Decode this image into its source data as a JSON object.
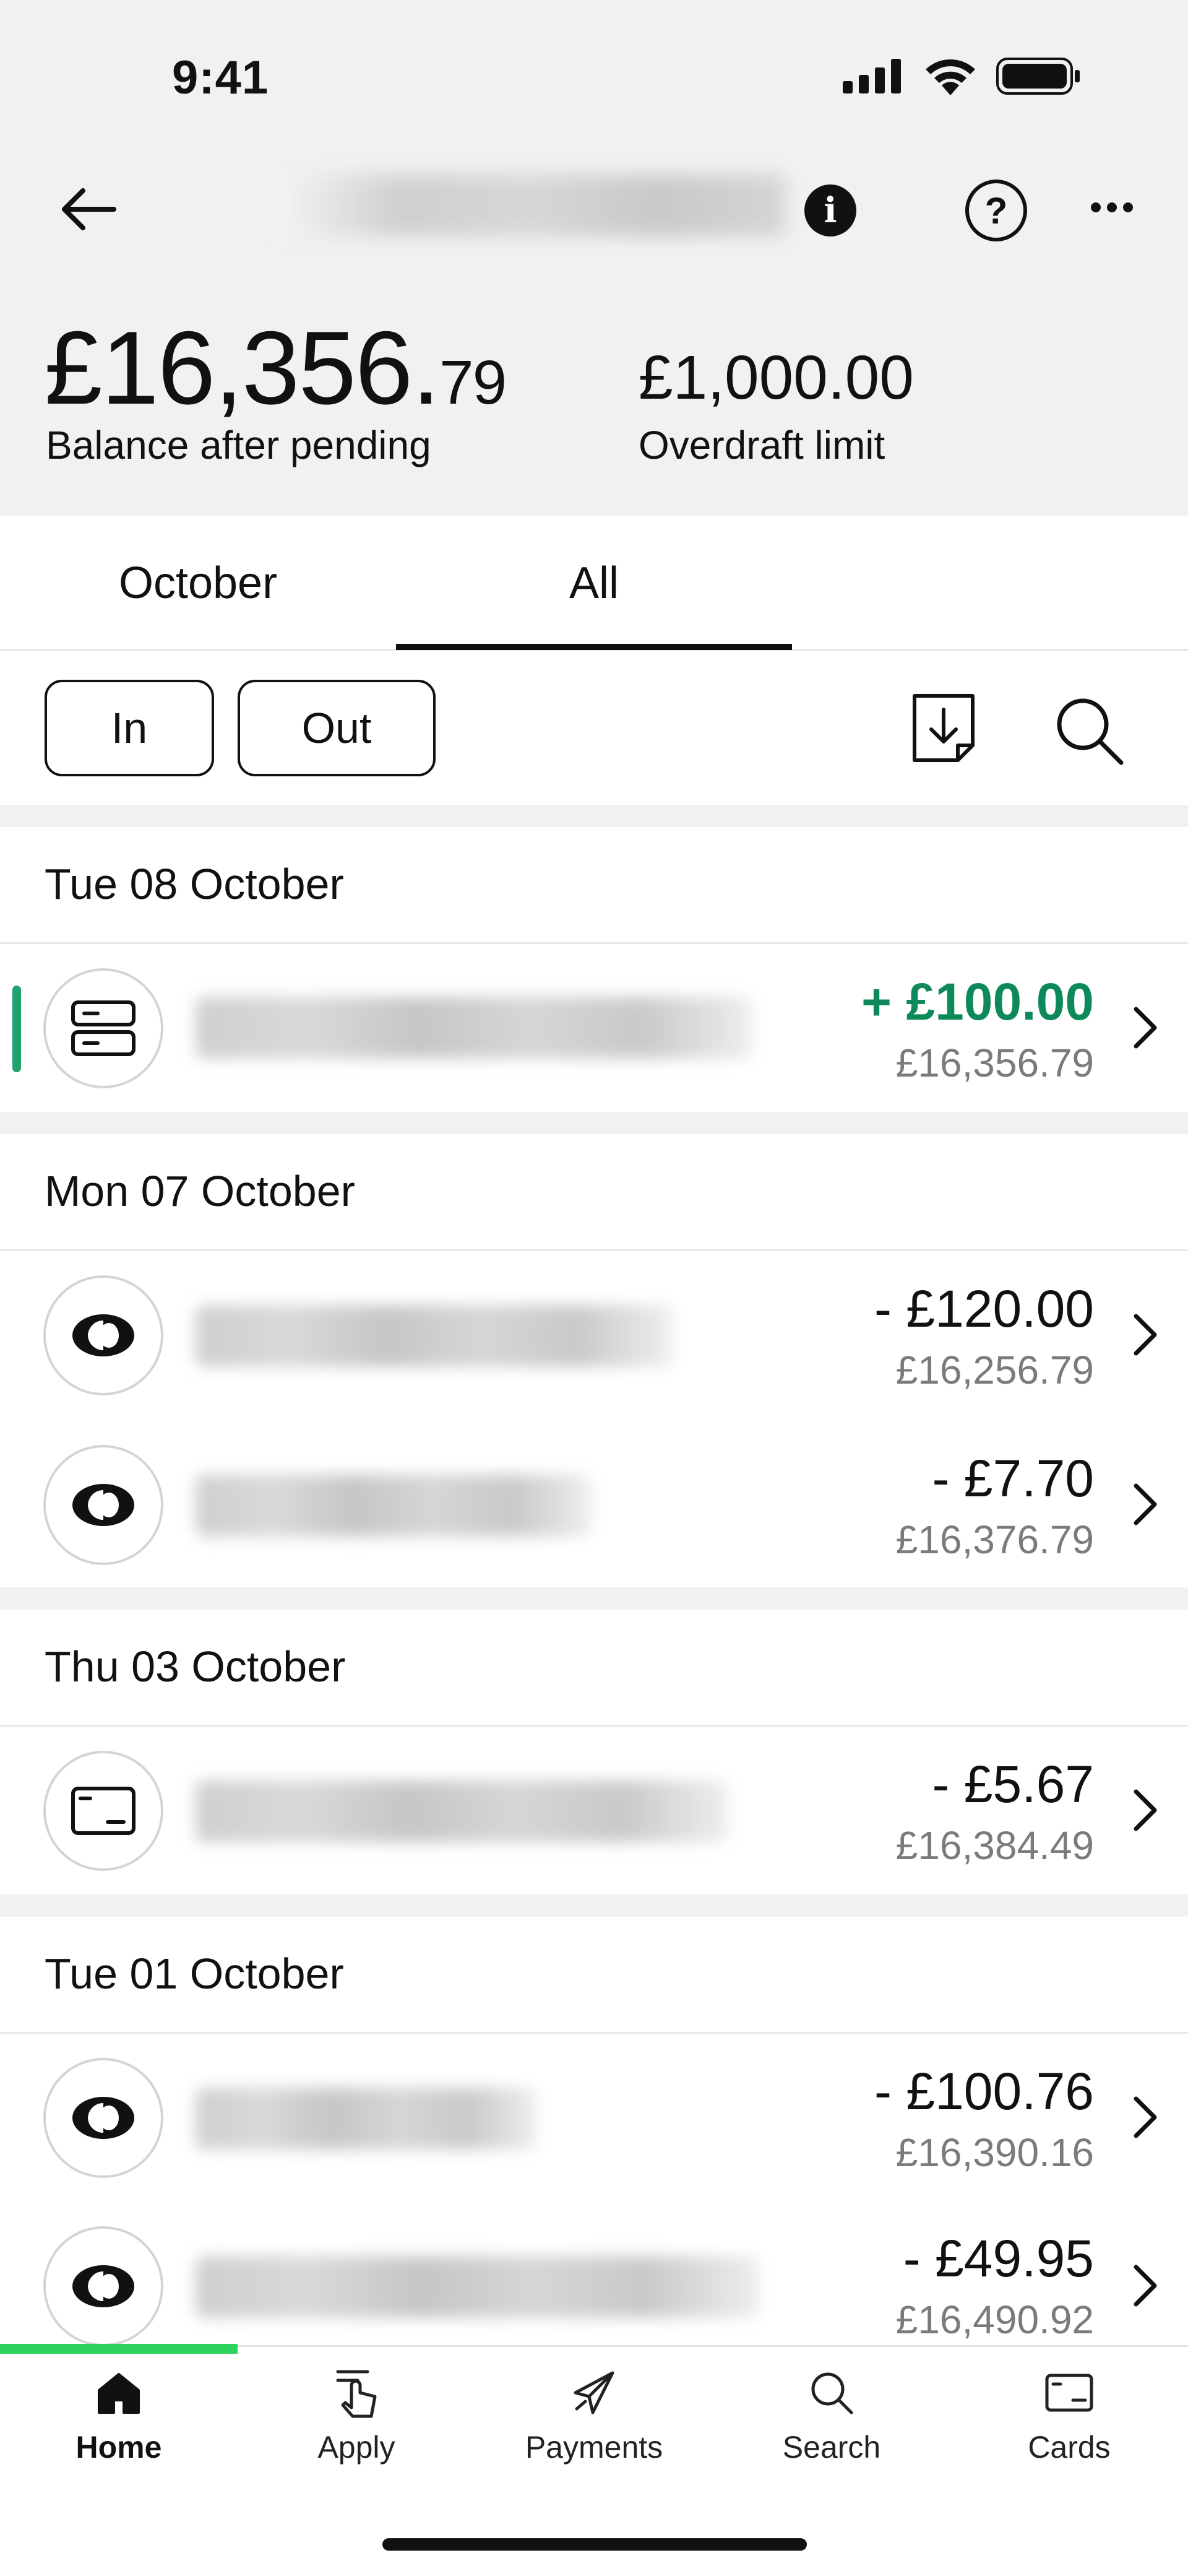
{
  "status_bar": {
    "time": "9:41"
  },
  "header": {
    "balance_whole": "£16,356.",
    "balance_pence": "79",
    "balance_label": "Balance after pending",
    "overdraft_value": "£1,000.00",
    "overdraft_label": "Overdraft limit"
  },
  "tabs": [
    {
      "label": "October",
      "selected": false
    },
    {
      "label": "All",
      "selected": true
    }
  ],
  "filters": {
    "in_label": "In",
    "out_label": "Out"
  },
  "groups": [
    {
      "date": "Tue 08 October",
      "transactions": [
        {
          "icon": "bank-transfer-icon",
          "amount": "+ £100.00",
          "balance": "£16,356.79",
          "direction": "in",
          "pending": true
        }
      ]
    },
    {
      "date": "Mon 07 October",
      "transactions": [
        {
          "icon": "direct-debit-icon",
          "amount": "- £120.00",
          "balance": "£16,256.79",
          "direction": "out"
        },
        {
          "icon": "direct-debit-icon",
          "amount": "- £7.70",
          "balance": "£16,376.79",
          "direction": "out"
        }
      ]
    },
    {
      "date": "Thu 03 October",
      "transactions": [
        {
          "icon": "card-payment-icon",
          "amount": "- £5.67",
          "balance": "£16,384.49",
          "direction": "out"
        }
      ]
    },
    {
      "date": "Tue 01 October",
      "transactions": [
        {
          "icon": "direct-debit-icon",
          "amount": "- £100.76",
          "balance": "£16,390.16",
          "direction": "out"
        },
        {
          "icon": "direct-debit-icon",
          "amount": "- £49.95",
          "balance": "£16,490.92",
          "direction": "out"
        }
      ]
    }
  ],
  "nav": [
    {
      "label": "Home",
      "icon": "home-icon",
      "active": true
    },
    {
      "label": "Apply",
      "icon": "apply-icon",
      "active": false
    },
    {
      "label": "Payments",
      "icon": "payments-icon",
      "active": false
    },
    {
      "label": "Search",
      "icon": "search-icon",
      "active": false
    },
    {
      "label": "Cards",
      "icon": "card-icon",
      "active": false
    }
  ],
  "colors": {
    "credit": "#0e8a5a",
    "progress": "#2ed35d",
    "header_bg": "#f1f1f1"
  }
}
